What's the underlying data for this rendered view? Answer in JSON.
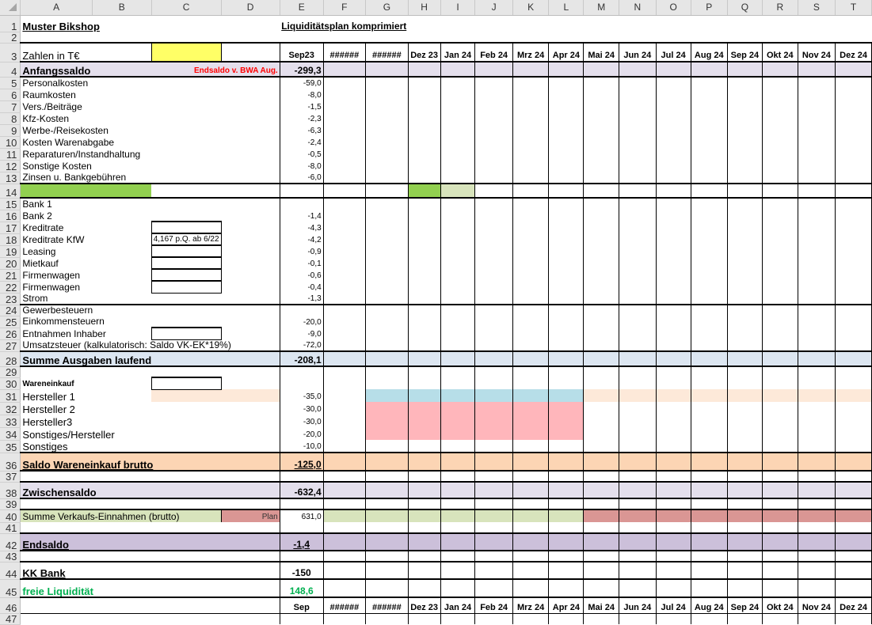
{
  "colors": {
    "purple": "#e4dfec",
    "blue": "#dce6f1",
    "orange": "#fcd5b4",
    "lightOrange": "#fde9d9",
    "green": "#d8e4bc",
    "brightGreen": "#92d050",
    "yellow": "#ffff66",
    "lightBlue": "#b7dee8",
    "pink": "#ffb6bb",
    "dustyRed": "#da9694",
    "violet": "#ccc0da",
    "red": "#ff0000",
    "freeGreen": "#00b050"
  },
  "columns": [
    "A",
    "B",
    "C",
    "D",
    "E",
    "F",
    "G",
    "H",
    "I",
    "J",
    "K",
    "L",
    "M",
    "N",
    "O",
    "P",
    "Q",
    "R",
    "S",
    "T"
  ],
  "header": {
    "title": "Muster Bikshop",
    "plan_title": "Liquiditätsplan komprimiert"
  },
  "units_label": "Zahlen in T€",
  "months_row3": [
    "Sep23",
    "######",
    "######",
    "Dez 23",
    "Jan 24",
    "Feb 24",
    "Mrz 24",
    "Apr 24",
    "Mai 24",
    "Jun 24",
    "Jul 24",
    "Aug 24",
    "Sep 24",
    "Okt 24",
    "Nov 24",
    "Dez 24"
  ],
  "months_row46": [
    "Sep",
    "######",
    "######",
    "Dez 23",
    "Jan 24",
    "Feb 24",
    "Mrz 24",
    "Apr 24",
    "Mai 24",
    "Jun 24",
    "Jul 24",
    "Aug 24",
    "Sep 24",
    "Okt 24",
    "Nov 24",
    "Dez 24"
  ],
  "anfangssaldo": {
    "label": "Anfangssaldo",
    "note": "Endsaldo v. BWA Aug.",
    "value": "-299,3"
  },
  "costs": [
    {
      "row": "5",
      "label": "Personalkosten",
      "value": "-59,0"
    },
    {
      "row": "6",
      "label": "Raumkosten",
      "value": "-8,0"
    },
    {
      "row": "7",
      "label": "Vers./Beiträge",
      "value": "-1,5"
    },
    {
      "row": "8",
      "label": "Kfz-Kosten",
      "value": "-2,3"
    },
    {
      "row": "9",
      "label": "Werbe-/Reisekosten",
      "value": "-6,3"
    },
    {
      "row": "10",
      "label": "Kosten Warenabgabe",
      "value": "-2,4"
    },
    {
      "row": "11",
      "label": "Reparaturen/Instandhaltung",
      "value": "-0,5"
    },
    {
      "row": "12",
      "label": "Sonstige Kosten",
      "value": "-8,0"
    },
    {
      "row": "13",
      "label": "Zinsen u. Bankgebühren",
      "value": "-6,0"
    }
  ],
  "finance": [
    {
      "row": "15",
      "label": "Bank 1",
      "note": "",
      "value": ""
    },
    {
      "row": "16",
      "label": "Bank 2",
      "note": "",
      "value": "-1,4"
    },
    {
      "row": "17",
      "label": "Kreditrate",
      "note": "",
      "value": "-4,3"
    },
    {
      "row": "18",
      "label": "Kreditrate KfW",
      "note": "4,167 p.Q. ab 6/22",
      "value": "-4,2"
    },
    {
      "row": "19",
      "label": "Leasing",
      "note": "",
      "value": "-0,9"
    },
    {
      "row": "20",
      "label": " Mietkauf",
      "note": "",
      "value": "-0,1"
    },
    {
      "row": "21",
      "label": "Firmenwagen",
      "note": "",
      "value": "-0,6"
    },
    {
      "row": "22",
      "label": "Firmenwagen",
      "note": "",
      "value": "-0,4"
    },
    {
      "row": "23",
      "label": "Strom",
      "note": "",
      "value": "-1,3"
    }
  ],
  "taxes": [
    {
      "row": "24",
      "label": "Gewerbesteuern",
      "value": ""
    },
    {
      "row": "25",
      "label": "Einkommensteuern",
      "value": "-20,0"
    },
    {
      "row": "26",
      "label": "Entnahmen Inhaber",
      "value": "-9,0"
    },
    {
      "row": "27",
      "label": "Umsatzsteuer (kalkulatorisch: Saldo VK-EK*19%)",
      "value": "-72,0"
    }
  ],
  "summe_ausgaben": {
    "label": "Summe Ausgaben laufend",
    "value": "-208,1"
  },
  "wareneinkauf": {
    "label": "Wareneinkauf"
  },
  "hersteller": [
    {
      "row": "31",
      "label": "Hersteller 1",
      "value": "-35,0"
    },
    {
      "row": "32",
      "label": "Hersteller 2",
      "value": "-30,0"
    },
    {
      "row": "33",
      "label": "Hersteller3",
      "value": "-30,0"
    },
    {
      "row": "34",
      "label": "Sonstiges/Hersteller",
      "value": "-20,0"
    },
    {
      "row": "35",
      "label": "Sonstiges",
      "value": "-10,0"
    }
  ],
  "saldo_wareneinkauf": {
    "label": "Saldo Wareneinkauf brutto",
    "value": "-125,0"
  },
  "zwischensaldo": {
    "label": "Zwischensaldo",
    "value": "-632,4"
  },
  "verkauf": {
    "label": "Summe Verkaufs-Einnahmen (brutto)",
    "plan": "Plan",
    "value": "631,0"
  },
  "endsaldo": {
    "label": "Endsaldo",
    "value": "-1,4"
  },
  "kk_bank": {
    "label": "KK Bank",
    "value": "-150"
  },
  "freie_liquiditaet": {
    "label": "freie Liquidität",
    "value": "148,6"
  }
}
